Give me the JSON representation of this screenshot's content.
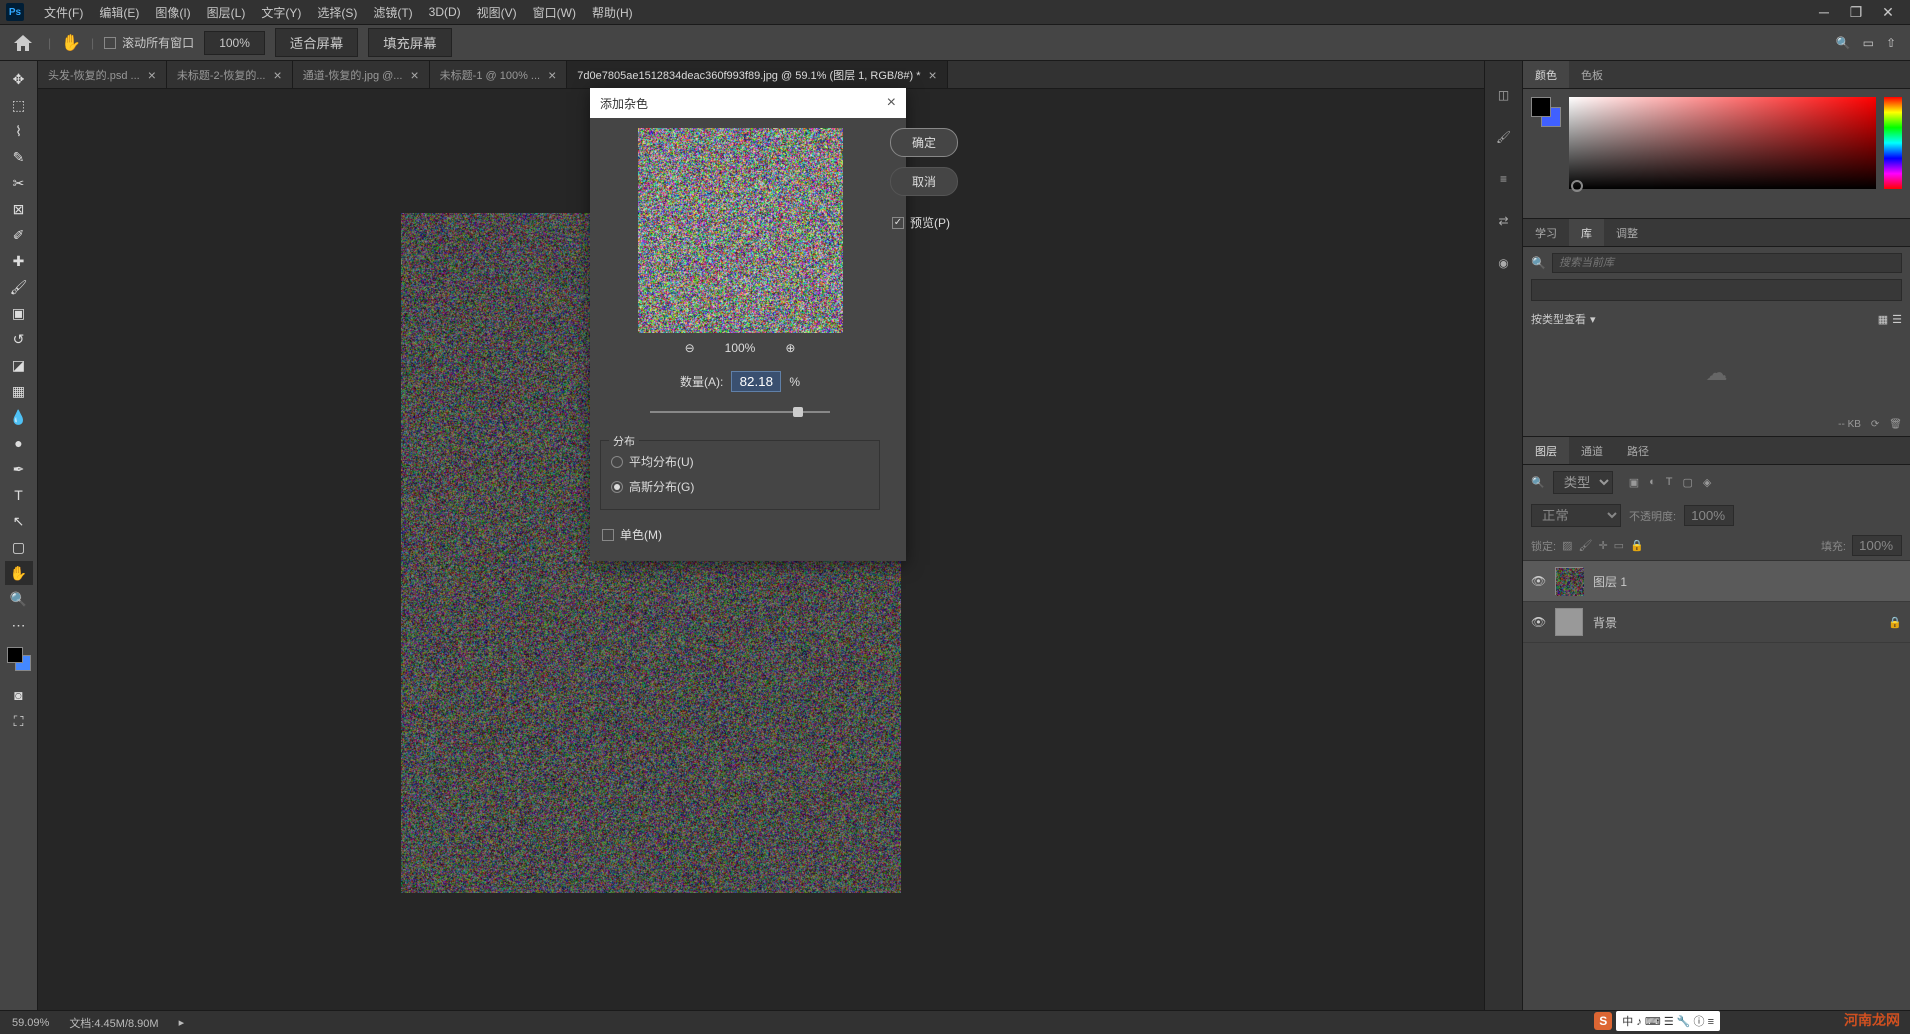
{
  "menu": {
    "file": "文件(F)",
    "edit": "编辑(E)",
    "image": "图像(I)",
    "layer": "图层(L)",
    "type": "文字(Y)",
    "select": "选择(S)",
    "filter": "滤镜(T)",
    "threeD": "3D(D)",
    "view": "视图(V)",
    "window": "窗口(W)",
    "help": "帮助(H)"
  },
  "options": {
    "scroll_all": "滚动所有窗口",
    "zoom": "100%",
    "fit_screen": "适合屏幕",
    "fill_screen": "填充屏幕"
  },
  "tabs": [
    {
      "label": "头发-恢复的.psd ..."
    },
    {
      "label": "未标题-2-恢复的..."
    },
    {
      "label": "通道-恢复的.jpg @..."
    },
    {
      "label": "未标题-1 @ 100% ..."
    },
    {
      "label": "7d0e7805ae1512834deac360f993f89.jpg @ 59.1% (图层 1, RGB/8#) *"
    }
  ],
  "dialog": {
    "title": "添加杂色",
    "ok": "确定",
    "cancel": "取消",
    "preview": "预览(P)",
    "preview_zoom": "100%",
    "amount_label": "数量(A):",
    "amount_value": "82.18",
    "amount_unit": "%",
    "distribution": "分布",
    "uniform": "平均分布(U)",
    "gaussian": "高斯分布(G)",
    "mono": "单色(M)"
  },
  "panels": {
    "color_tab": "颜色",
    "swatches_tab": "色板",
    "learn_tab": "学习",
    "library_tab": "库",
    "adjust_tab": "调整",
    "search_placeholder": "搜索当前库",
    "view_by": "按类型查看",
    "lib_size": "-- KB",
    "layers_tab": "图层",
    "channels_tab": "通道",
    "paths_tab": "路径",
    "filter_kind": "类型",
    "blend_mode": "正常",
    "opacity_label": "不透明度:",
    "opacity_value": "100%",
    "lock_label": "锁定:",
    "fill_label": "填充:",
    "fill_value": "100%",
    "layer1_name": "图层 1",
    "bg_name": "背景"
  },
  "status": {
    "zoom": "59.09%",
    "docinfo": "文档:4.45M/8.90M"
  },
  "watermark": "河南龙网"
}
